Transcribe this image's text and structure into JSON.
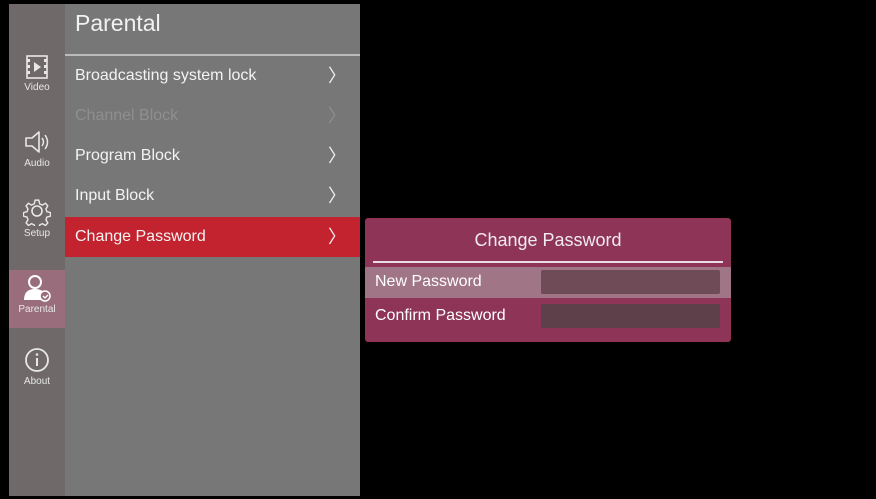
{
  "sidebar": {
    "items": [
      {
        "label": "Video",
        "icon": "video-icon"
      },
      {
        "label": "Audio",
        "icon": "speaker-icon"
      },
      {
        "label": "Setup",
        "icon": "gear-icon"
      },
      {
        "label": "Parental",
        "icon": "parental-user-icon",
        "active": true
      },
      {
        "label": "About",
        "icon": "info-icon"
      }
    ]
  },
  "menu": {
    "title": "Parental",
    "items": [
      {
        "label": "Broadcasting system lock",
        "chevron": "〉",
        "state": "normal"
      },
      {
        "label": "Channel Block",
        "chevron": "〉",
        "state": "disabled"
      },
      {
        "label": "Program Block",
        "chevron": "〉",
        "state": "normal"
      },
      {
        "label": "Input Block",
        "chevron": "〉",
        "state": "normal"
      },
      {
        "label": "Change Password",
        "chevron": "〉",
        "state": "active"
      }
    ]
  },
  "dialog": {
    "title": "Change Password",
    "fields": [
      {
        "label": "New Password",
        "value": ""
      },
      {
        "label": "Confirm Password",
        "value": ""
      }
    ]
  },
  "colors": {
    "sidebar_bg": "#6f6969",
    "menu_bg": "#777777",
    "active_item": "#c3232f",
    "dialog_bg": "#8d3457",
    "field_bg": "#5d404a"
  }
}
